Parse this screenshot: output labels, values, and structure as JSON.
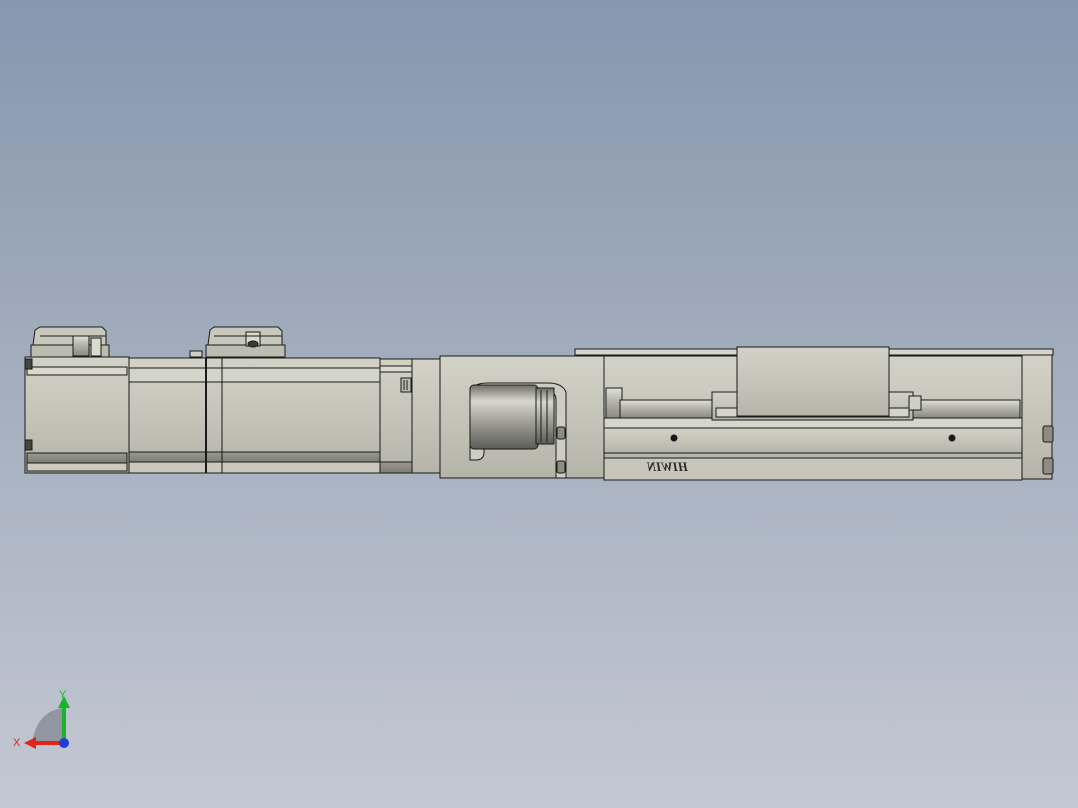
{
  "brand_label": "HIWIN",
  "triad": {
    "x_label": "X",
    "y_label": "Y",
    "x_color": "#e0251c",
    "y_color": "#16b52a",
    "z_color": "#1f3bd8"
  },
  "colors": {
    "background_top": "#8797ae",
    "background_bottom": "#c3c8d3",
    "body": "#c4c4b8",
    "body_light": "#d6d6ca",
    "body_dark": "#8e8e84",
    "edge": "#1a1a1a"
  }
}
